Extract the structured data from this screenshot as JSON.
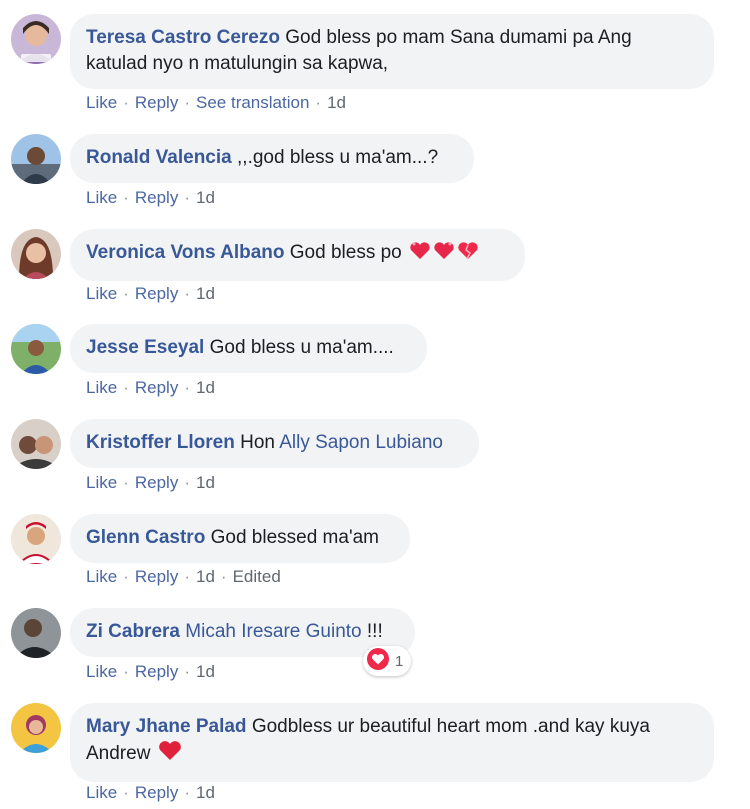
{
  "actions": {
    "like": "Like",
    "reply": "Reply",
    "see_translation": "See translation",
    "edited": "Edited"
  },
  "colors": {
    "author": "#385898",
    "bubble": "#f2f3f5",
    "action_link": "#4b67a1",
    "meta": "#616770",
    "heart": "#f0284a"
  },
  "comments": [
    {
      "author": "Teresa Castro Cerezo",
      "text": "God bless po mam Sana dumami pa Ang katulad nyo n matulungin sa kapwa,",
      "time": "1d"
    },
    {
      "author": "Ronald Valencia",
      "text": ",,.god bless u ma'am...?",
      "time": "1d"
    },
    {
      "author": "Veronica Vons Albano",
      "text": "God bless po",
      "emoji": "sparkling-heart-icons",
      "time": "1d"
    },
    {
      "author": "Jesse Eseyal",
      "text": "God bless u ma'am....",
      "time": "1d"
    },
    {
      "author": "Kristoffer Lloren",
      "text": "Hon",
      "mention": "Ally Sapon Lubiano",
      "time": "1d"
    },
    {
      "author": "Glenn Castro",
      "text": "God blessed ma'am",
      "time": "1d"
    },
    {
      "author": "Zi Cabrera",
      "mention": "Micah Iresare Guinto",
      "text": "!!!",
      "time": "1d",
      "reaction": {
        "icon": "love-reaction-icon",
        "count": "1"
      }
    },
    {
      "author": "Mary Jhane Palad",
      "text": "Godbless ur beautiful heart mom .and kay kuya Andrew",
      "emoji": "red-heart-icon",
      "time": "1d"
    }
  ]
}
